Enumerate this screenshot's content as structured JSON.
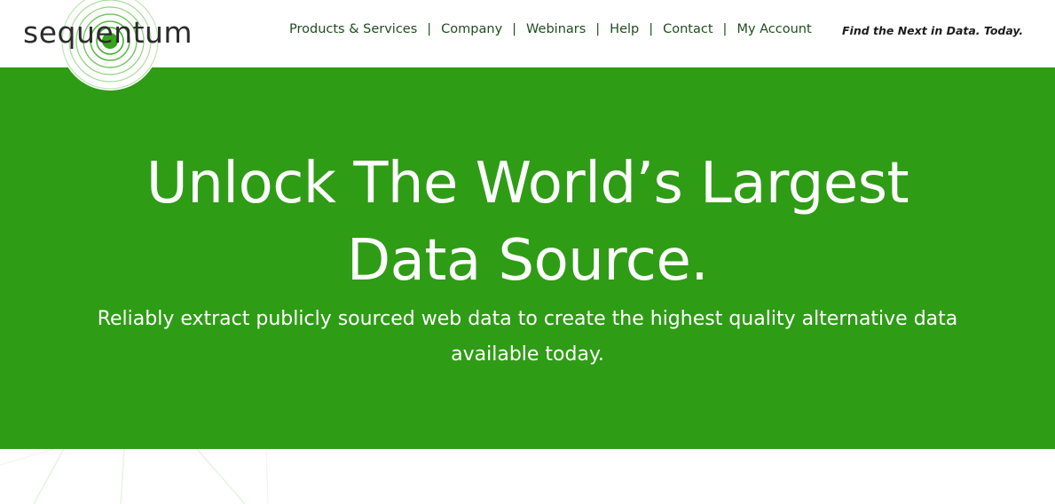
{
  "brand": {
    "logo_text": "sequentum",
    "accent_color": "#2f9c16",
    "logo_ring_color": "#7cc96a"
  },
  "nav": {
    "items": [
      {
        "label": "Products & Services"
      },
      {
        "label": "Company"
      },
      {
        "label": "Webinars"
      },
      {
        "label": "Help"
      },
      {
        "label": "Contact"
      },
      {
        "label": "My Account"
      }
    ],
    "separator": "|"
  },
  "tagline": "Find the Next in Data. Today.",
  "hero": {
    "title_line1": "Unlock The World’s Largest",
    "title_line2": "Data Source.",
    "subtitle_line1": "Reliably extract publicly sourced web data to create the highest quality alternative data",
    "subtitle_line2": "available today.",
    "background_color": "#2f9c16"
  }
}
